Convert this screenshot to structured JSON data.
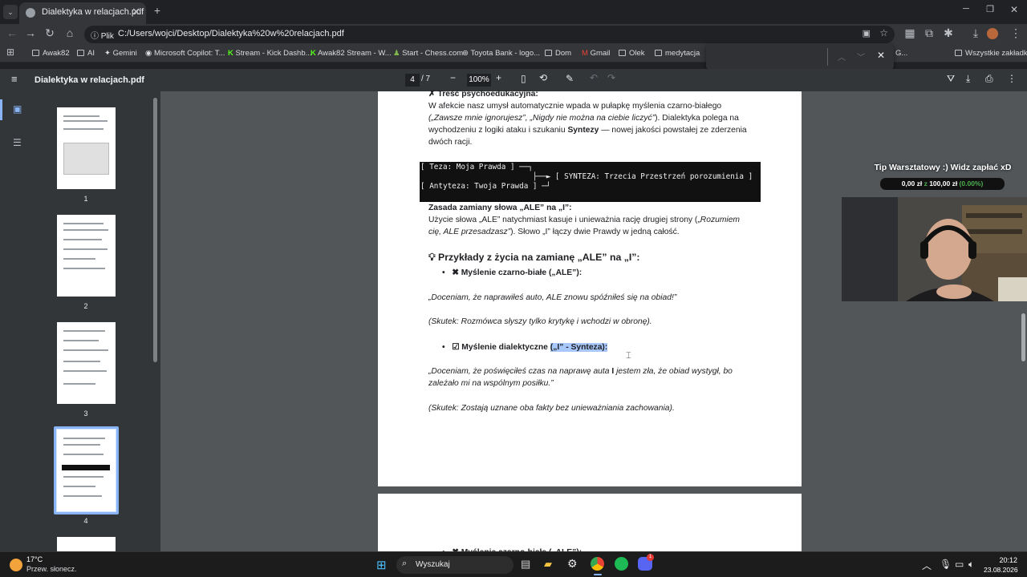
{
  "tab": {
    "title": "Dialektyka w relacjach.pdf"
  },
  "address": {
    "chip": "Plik",
    "url": "C:/Users/wojci/Desktop/Dialektyka%20w%20relacjach.pdf"
  },
  "bookmarks": [
    {
      "label": "Awak82"
    },
    {
      "label": "AI"
    },
    {
      "label": "Gemini"
    },
    {
      "label": "Microsoft Copilot: T..."
    },
    {
      "label": "Stream - Kick Dashb..."
    },
    {
      "label": "Awak82 Stream - W..."
    },
    {
      "label": "Start - Chess.com"
    },
    {
      "label": "Toyota Bank - logo..."
    },
    {
      "label": "Dom"
    },
    {
      "label": "Gmail"
    },
    {
      "label": "Olek"
    },
    {
      "label": "medytacja"
    },
    {
      "label": "G..."
    },
    {
      "label": "Wszystkie zakładki"
    }
  ],
  "pdf": {
    "title": "Dialektyka w relacjach.pdf",
    "page_current": "4",
    "page_total": "/ 7",
    "zoom": "100%"
  },
  "thumbnails": [
    {
      "num": "1"
    },
    {
      "num": "2"
    },
    {
      "num": "3"
    },
    {
      "num": "4"
    }
  ],
  "content": {
    "heading_cut": "Treść psychoedukacyjna:",
    "p1_l1": "W afekcie nasz umysł automatycznie wpada w pułapkę myślenia czarno-białego",
    "p1_l2_i": "(„Zawsze mnie ignorujesz”, „Nigdy nie można na ciebie liczyć”",
    "p1_l2_r": "). Dialektyka polega na",
    "p1_l3_a": "wychodzeniu z logiki ataku i szukaniu ",
    "p1_l3_b": "Syntezy",
    "p1_l3_c": " — nowej jakości powstałej ze zderzenia",
    "p1_l4": "dwóch racji.",
    "code_l1": "[ Teza: Moja Prawda ] ──┐",
    "code_l2": "                         ├──► [ SYNTEZA: Trzecia Przestrzeń porozumienia ]",
    "code_l3": "[ Antyteza: Twoja Prawda ] ─┘",
    "rule_heading": "Zasada zamiany słowa „ALE” na „I”:",
    "rule_l1_a": "Użycie słowa „ALE” natychmiast kasuje i unieważnia rację drugiej strony („",
    "rule_l1_i": "Rozumiem",
    "rule_l2_i": "cię, ALE przesadzasz”",
    "rule_l2_r": "). Słowo „I” łączy dwie Prawdy w jedną całość.",
    "examples_heading": "Przykłady z życia na zamianę „ALE” na „I”:",
    "bullet1": "Myślenie czarno-białe („ALE”):",
    "quote1": "„Doceniam, że naprawiłeś auto, ALE znowu spóźniłeś się na obiad!”",
    "effect1": "(Skutek: Rozmówca słyszy tylko krytykę i wchodzi w obronę).",
    "bullet2_a": "Myślenie dialektyczne ",
    "bullet2_b": "(„I” - Synteza):",
    "quote2_l1_a": "„Doceniam, że poświęciłeś czas na naprawę auta ",
    "quote2_l1_b": "I",
    "quote2_l1_c": " jestem zła, że obiad wystygł, bo",
    "quote2_l2": "zależało mi na wspólnym posiłku.”",
    "effect2": "(Skutek: Zostają uznane oba fakty bez unieważniania zachowania).",
    "next_page_bullet": "Myślenie czarno-białe („ALE”):"
  },
  "overlay": {
    "tip_title": "Tip Warsztatowy :) Widz zapłać xD",
    "tip_progress_a": "0,00 zł",
    "tip_progress_b": " z ",
    "tip_progress_c": "100,00 zł",
    "tip_progress_d": " (0.00%)",
    "progress": 0
  },
  "taskbar": {
    "weather_temp": "17°C",
    "weather_desc": "Przew. słonecz.",
    "search_placeholder": "Wyszukaj",
    "time": "20:12",
    "date": "23.08.2026",
    "discord_badge": "1"
  },
  "colors": {
    "highlight": "#a8c7fa",
    "accent": "#8ab4f8",
    "tip_green": "#4caf50"
  }
}
